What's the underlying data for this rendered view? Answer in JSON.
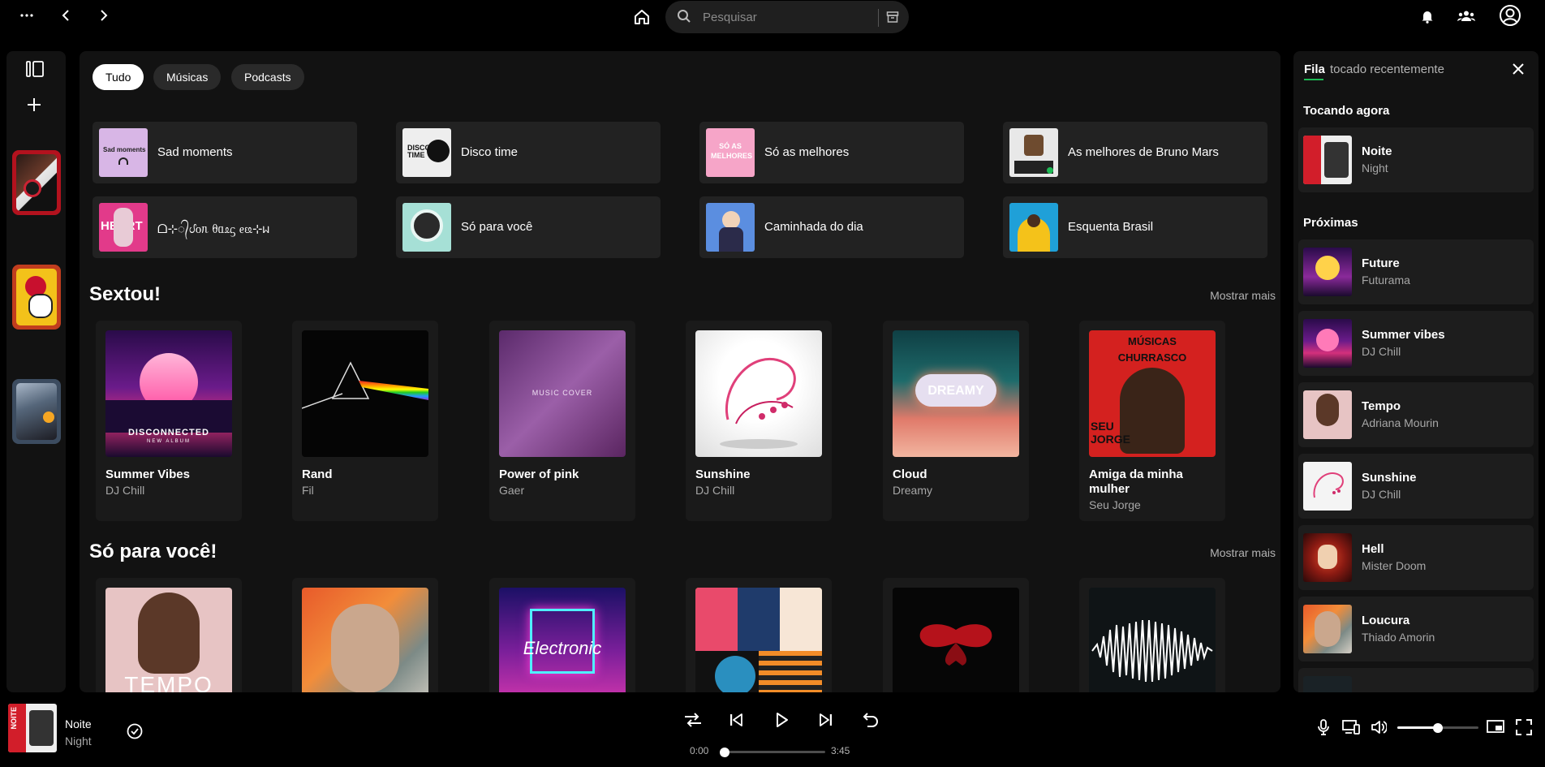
{
  "topbar": {
    "search_placeholder": "Pesquisar"
  },
  "filters": [
    "Tudo",
    "Músicas",
    "Podcasts"
  ],
  "quick_picks": [
    "Sad moments",
    "Disco time",
    "Só as melhores",
    "As melhores de Bruno Mars",
    "ᗝ⊹᭄ᦔᦞᥰ ᦲᥲᦸᦓ ᧉᦕ⊹ᥕ",
    "Só para você",
    "Caminhada do dia",
    "Esquenta Brasil"
  ],
  "quick_art_text": {
    "sad": "Sad moments",
    "disco": "DISCO TIME",
    "so": "SÓ AS MELHORES",
    "pink": "HEART"
  },
  "sections": {
    "sextou": {
      "title": "Sextou!",
      "more": "Mostrar mais"
    },
    "sopravoce": {
      "title": "Só para você!",
      "more": "Mostrar mais"
    }
  },
  "sextou_cards": [
    {
      "title": "Summer Vibes",
      "subtitle": "DJ Chill"
    },
    {
      "title": "Rand",
      "subtitle": "Fil"
    },
    {
      "title": "Power of pink",
      "subtitle": "Gaer"
    },
    {
      "title": "Sunshine",
      "subtitle": "DJ Chill"
    },
    {
      "title": "Cloud",
      "subtitle": "Dreamy"
    },
    {
      "title": "Amiga da minha mulher",
      "subtitle": "Seu Jorge"
    }
  ],
  "art_text": {
    "disconnected": "DISCONNECTED",
    "new_album": "NEW ALBUM",
    "music_cover": "MUSIC COVER",
    "dreamy": "DREAMY",
    "musicas": "MÚSICAS",
    "churrasco": "CHURRASCO",
    "seu_jorge": "SEU JORGE",
    "tempo": "TEMPO",
    "electronic": "Electronic",
    "noite": "NOITE"
  },
  "queue": {
    "tab_active": "Fila",
    "tab_other": "tocado recentemente",
    "now_playing_label": "Tocando agora",
    "now_playing": {
      "title": "Noite",
      "subtitle": "Night"
    },
    "next_label": "Próximas",
    "next": [
      {
        "title": "Future",
        "subtitle": "Futurama"
      },
      {
        "title": "Summer vibes",
        "subtitle": "DJ Chill"
      },
      {
        "title": "Tempo",
        "subtitle": "Adriana Mourin"
      },
      {
        "title": "Sunshine",
        "subtitle": "DJ Chill"
      },
      {
        "title": "Hell",
        "subtitle": "Mister Doom"
      },
      {
        "title": "Loucura",
        "subtitle": "Thiado Amorin"
      }
    ]
  },
  "player": {
    "title": "Noite",
    "subtitle": "Night",
    "time_current": "0:00",
    "time_total": "3:45",
    "progress": 0,
    "volume": 0.5
  },
  "colors": {
    "background": "#000000",
    "panel": "#121212",
    "card": "#1a1a1a",
    "accent": "#1db954"
  }
}
